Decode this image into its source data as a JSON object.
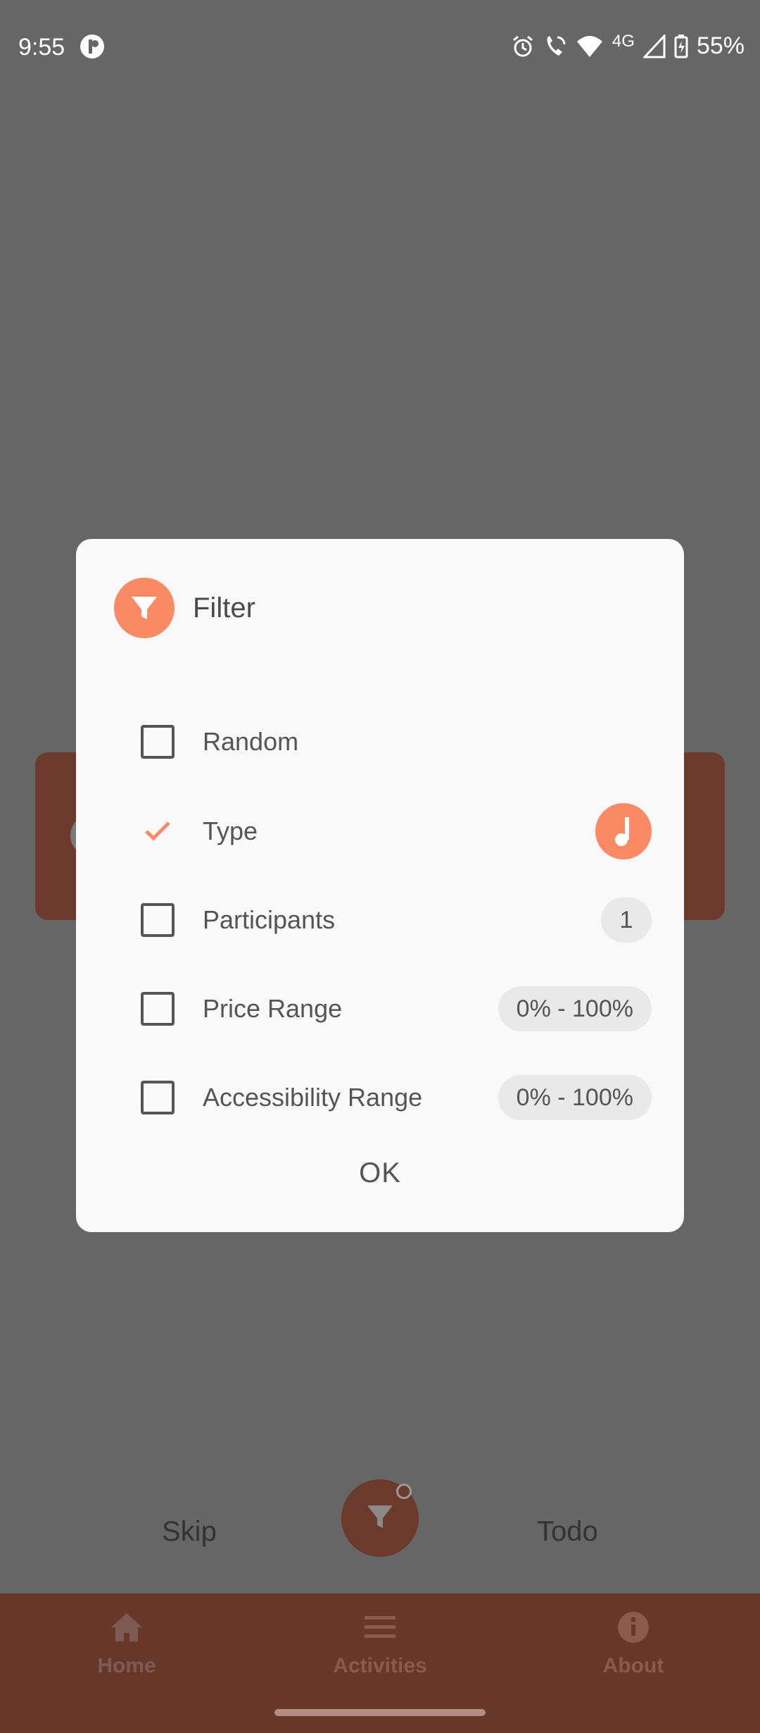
{
  "status_bar": {
    "time": "9:55",
    "network": "4G",
    "battery": "55%"
  },
  "dialog": {
    "title": "Filter",
    "title_icon": "filter-icon",
    "options": [
      {
        "label": "Random",
        "checked": false
      },
      {
        "label": "Type",
        "checked": true,
        "value_icon": "music-note-icon"
      },
      {
        "label": "Participants",
        "checked": false,
        "value": "1"
      },
      {
        "label": "Price Range",
        "checked": false,
        "value": "0% - 100%"
      },
      {
        "label": "Accessibility Range",
        "checked": false,
        "value": "0% - 100%"
      }
    ],
    "ok_label": "OK"
  },
  "actions": {
    "skip_label": "Skip",
    "todo_label": "Todo",
    "fab_icon": "filter-icon"
  },
  "nav": {
    "items": [
      {
        "label": "Home",
        "icon": "home-icon"
      },
      {
        "label": "Activities",
        "icon": "list-icon"
      },
      {
        "label": "About",
        "icon": "info-icon"
      }
    ]
  },
  "colors": {
    "accent": "#f98a63",
    "scrim": "#666666",
    "primary_dark": "#6b3a2c"
  }
}
